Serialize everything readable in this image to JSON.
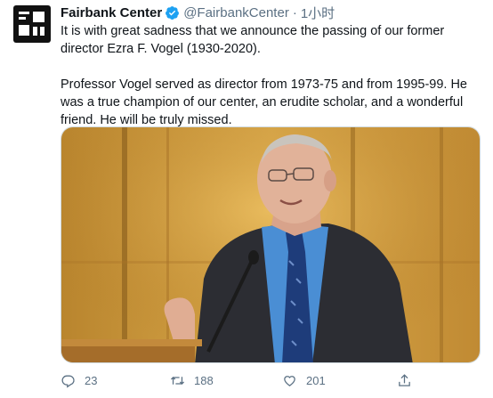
{
  "tweet": {
    "author_name": "Fairbank Center",
    "handle": "@FairbankCenter",
    "separator": "·",
    "time": "1小时",
    "paragraphs": [
      "It is with great sadness that we announce the passing of our former director Ezra F. Vogel (1930-2020).",
      "Professor Vogel served as director from 1973-75 and from 1995-99. He was a true champion of our center, an erudite scholar, and a wonderful friend. He will be truly missed."
    ]
  },
  "actions": {
    "reply_count": "23",
    "retweet_count": "188",
    "like_count": "201"
  },
  "colors": {
    "verified_badge": "#1da1f2",
    "secondary_text": "#5b7083",
    "avatar_bg": "#111111"
  },
  "icons": {
    "verified": "verified-badge-icon",
    "reply": "reply-icon",
    "retweet": "retweet-icon",
    "like": "heart-icon",
    "share": "share-icon"
  }
}
